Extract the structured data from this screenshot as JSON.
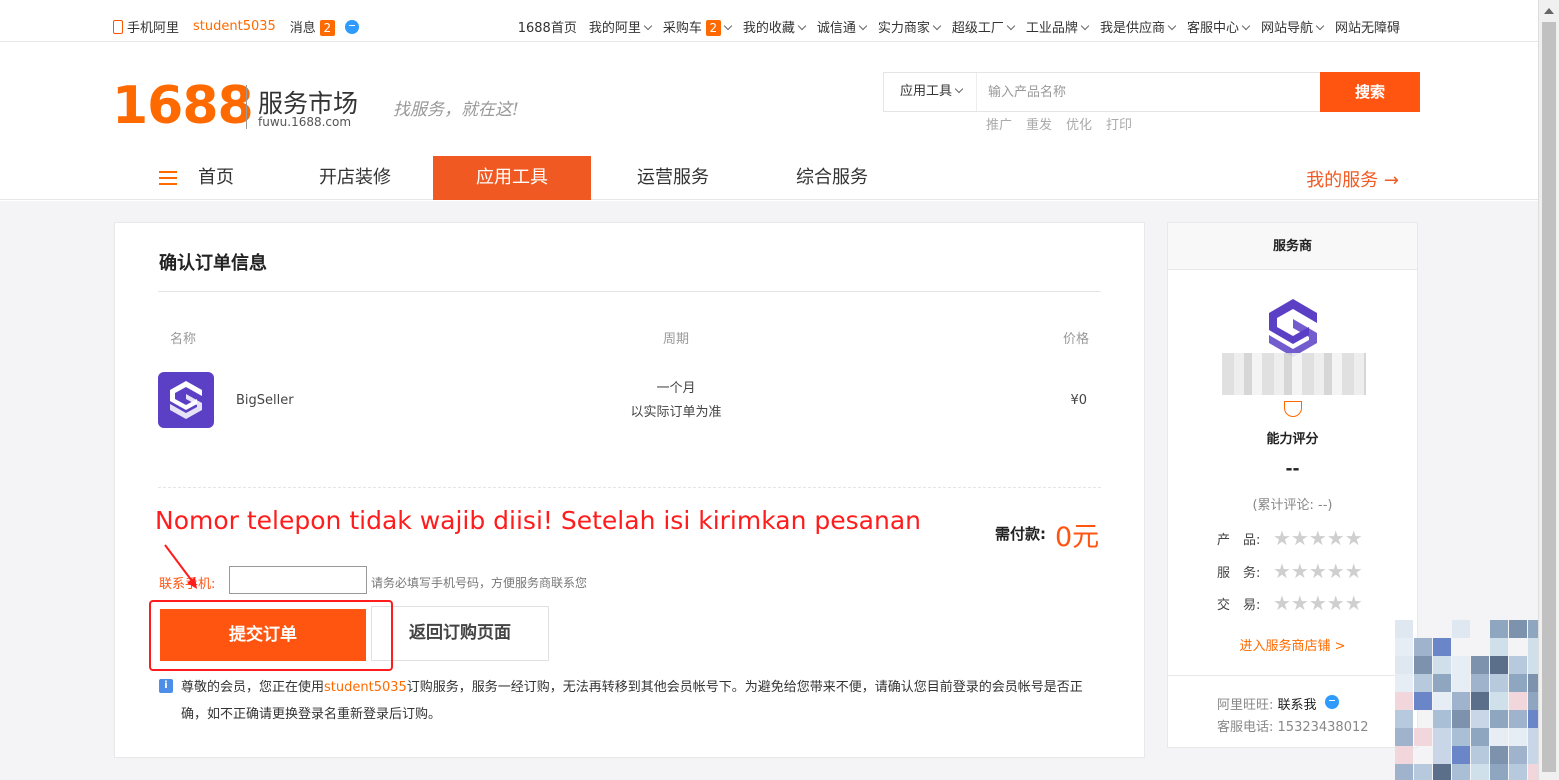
{
  "topbar": {
    "mobile": "手机阿里",
    "username": "student5035",
    "messages_label": "消息",
    "messages_count": "2",
    "links": [
      "1688首页",
      "我的阿里",
      "采购车",
      "我的收藏",
      "诚信通",
      "实力商家",
      "超级工厂",
      "工业品牌",
      "我是供应商",
      "客服中心",
      "网站导航",
      "网站无障碍"
    ],
    "cart_count": "2"
  },
  "header": {
    "logo_number": "1688",
    "logo_title": "服务市场",
    "logo_sub": "fuwu.1688.com",
    "slogan": "找服务，就在这!",
    "search_category": "应用工具",
    "search_placeholder": "输入产品名称",
    "search_button": "搜索",
    "hot_words": [
      "推广",
      "重发",
      "优化",
      "打印"
    ]
  },
  "nav": {
    "items": [
      "首页",
      "开店装修",
      "应用工具",
      "运营服务",
      "综合服务"
    ],
    "active": "应用工具",
    "my_service": "我的服务 →"
  },
  "order": {
    "title": "确认订单信息",
    "col_name": "名称",
    "col_period": "周期",
    "col_price": "价格",
    "product_name": "BigSeller",
    "period_line1": "一个月",
    "period_line2": "以实际订单为准",
    "price": "¥0",
    "annotation": "Nomor telepon tidak wajib diisi! Setelah isi kirimkan pesanan",
    "pay_label": "需付款:",
    "pay_value": "0元",
    "phone_label": "联系手机:",
    "phone_value": "",
    "phone_hint": "请务必填写手机号码，方便服务商联系您",
    "submit_button": "提交订单",
    "back_button": "返回订购页面",
    "notice_pre": "尊敬的会员，您正在使用",
    "notice_user": "student5035",
    "notice_post": "订购服务，服务一经订购，无法再转移到其他会员帐号下。为避免给您带来不便，请确认您目前登录的会员帐号是否正确，如不正确请更换登录名重新登录后订购。"
  },
  "provider": {
    "header": "服务商",
    "rating_title": "能力评分",
    "rating_value": "--",
    "reviews": "(累计评论: --)",
    "rows": [
      {
        "label": "产　品:",
        "stars": "★★★★★"
      },
      {
        "label": "服　务:",
        "stars": "★★★★★"
      },
      {
        "label": "交　易:",
        "stars": "★★★★★"
      }
    ],
    "shop_link": "进入服务商店铺 >",
    "wangwang_label": "阿里旺旺:",
    "wangwang_value": "联系我",
    "tel_label": "客服电话:",
    "tel_value": "15323438012"
  },
  "colors": {
    "brand_orange": "#ff6a00",
    "active_nav": "#f05a22",
    "annotation_red": "#ff1c1c",
    "bigseller_purple": "#5b3fc5"
  }
}
